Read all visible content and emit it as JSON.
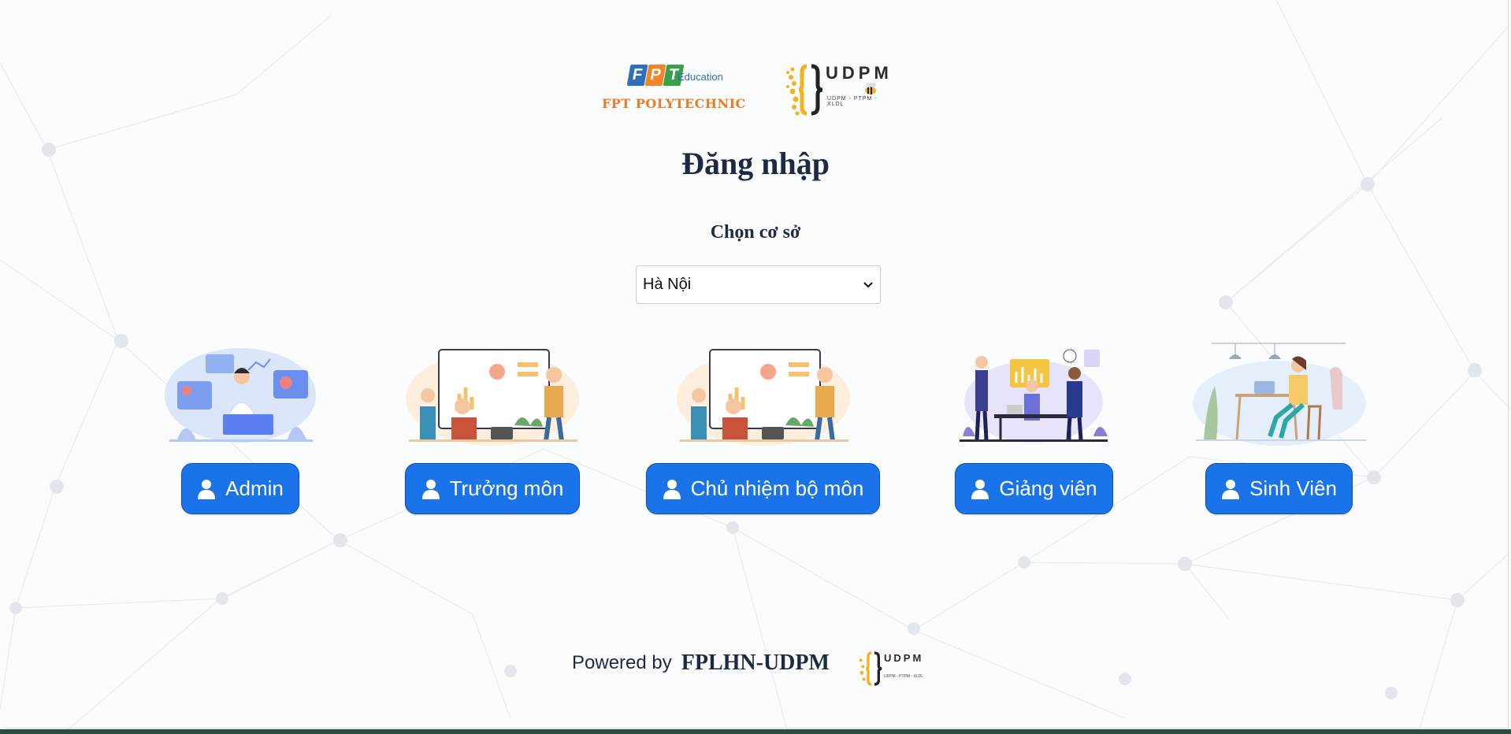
{
  "logos": {
    "fpt_letters": [
      "F",
      "P",
      "T"
    ],
    "fpt_education": "Education",
    "fpt_polytechnic": "FPT POLYTECHNIC",
    "udpm_text": "UDPM",
    "udpm_sub": "UDPM - PTPM - XLDL"
  },
  "title": "Đăng nhập",
  "campus": {
    "label": "Chọn cơ sở",
    "selected": "Hà Nội"
  },
  "roles": [
    {
      "label": "Admin"
    },
    {
      "label": "Trưởng môn"
    },
    {
      "label": "Chủ nhiệm bộ môn"
    },
    {
      "label": "Giảng viên"
    },
    {
      "label": "Sinh Viên"
    }
  ],
  "footer": {
    "powered_by": "Powered by",
    "brand": "FPLHN-UDPM",
    "logo_text": "UDPM",
    "logo_sub": "UDPM - PTPM - XLDL"
  },
  "colors": {
    "primary_button": "#1a73e8",
    "text": "#1e2a44",
    "fpt_orange": "#ee7a22",
    "udpm_yellow": "#f2b21d"
  }
}
